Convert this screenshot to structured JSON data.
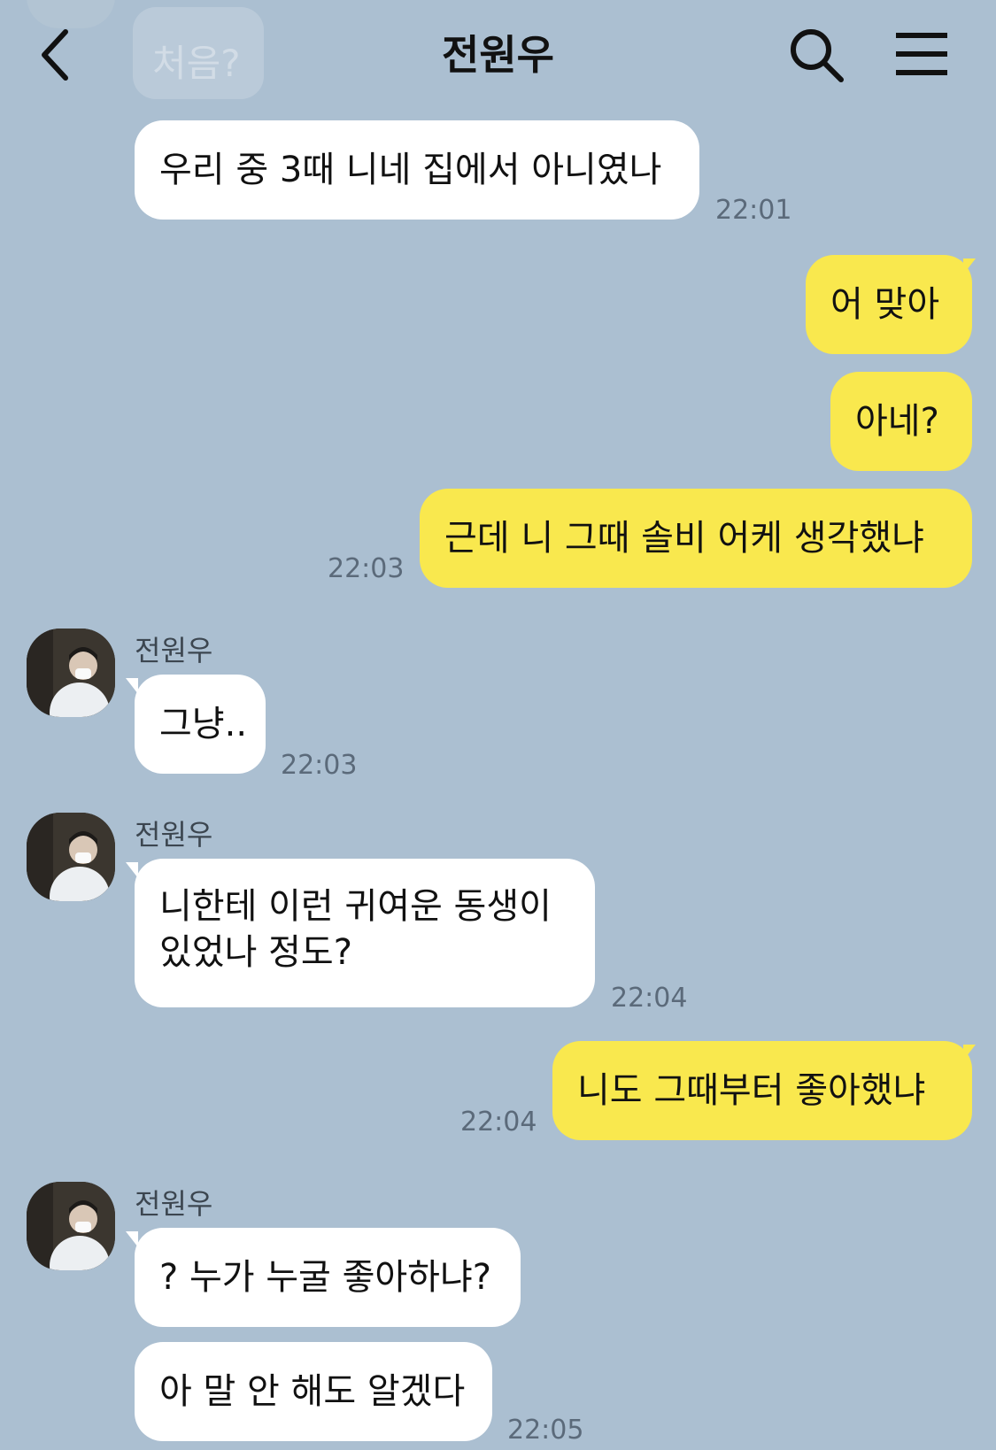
{
  "header": {
    "title": "전원우",
    "back_icon": "chevron-left-icon",
    "search_icon": "search-icon",
    "menu_icon": "hamburger-menu-icon"
  },
  "faded_message": "처음?",
  "messages": [
    {
      "side": "received",
      "text": "우리 중 3때 니네 집에서 아니였나",
      "time": "22:01"
    },
    {
      "side": "sent",
      "text": "어 맞아"
    },
    {
      "side": "sent",
      "text": "아네?"
    },
    {
      "side": "sent",
      "text": "근데 니 그때 솔비 어케 생각했냐",
      "time": "22:03"
    },
    {
      "side": "received",
      "sender": "전원우",
      "text": "그냥..",
      "time": "22:03"
    },
    {
      "side": "received",
      "sender": "전원우",
      "text": "니한테 이런 귀여운 동생이 있었나 정도?",
      "line1": "니한테 이런 귀여운 동생이",
      "line2": "있었나 정도?",
      "time": "22:04"
    },
    {
      "side": "sent",
      "text": "니도 그때부터 좋아했냐",
      "time": "22:04"
    },
    {
      "side": "received",
      "sender": "전원우",
      "text": "? 누가 누굴 좋아하냐?"
    },
    {
      "side": "received",
      "text": "아 말 안 해도 알겠다",
      "time": "22:05"
    }
  ],
  "colors": {
    "background": "#abbfd1",
    "sent_bubble": "#f9e84e",
    "received_bubble": "#ffffff"
  }
}
